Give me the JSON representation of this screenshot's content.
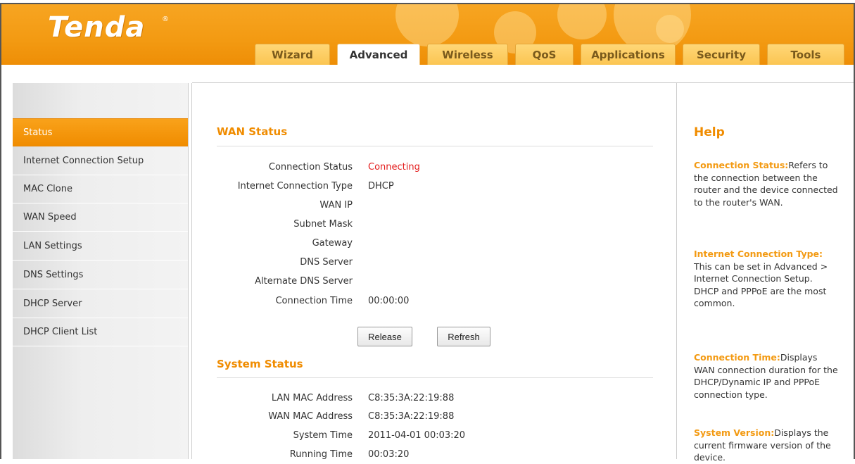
{
  "brand": {
    "logo_text": "Tenda",
    "registered": "®"
  },
  "tabs": [
    {
      "label": "Wizard"
    },
    {
      "label": "Advanced"
    },
    {
      "label": "Wireless"
    },
    {
      "label": "QoS"
    },
    {
      "label": "Applications"
    },
    {
      "label": "Security"
    },
    {
      "label": "Tools"
    }
  ],
  "active_tab": "Advanced",
  "sidebar": {
    "items": [
      {
        "label": "Status"
      },
      {
        "label": "Internet Connection Setup"
      },
      {
        "label": "MAC Clone"
      },
      {
        "label": "WAN Speed"
      },
      {
        "label": "LAN Settings"
      },
      {
        "label": "DNS Settings"
      },
      {
        "label": "DHCP Server"
      },
      {
        "label": "DHCP Client List"
      }
    ],
    "active": "Status"
  },
  "wan": {
    "title": "WAN Status",
    "rows": [
      {
        "label": "Connection Status",
        "value": "Connecting"
      },
      {
        "label": "Internet Connection Type",
        "value": "DHCP"
      },
      {
        "label": "WAN IP",
        "value": ""
      },
      {
        "label": "Subnet Mask",
        "value": ""
      },
      {
        "label": "Gateway",
        "value": ""
      },
      {
        "label": "DNS Server",
        "value": ""
      },
      {
        "label": "Alternate DNS Server",
        "value": ""
      },
      {
        "label": "Connection Time",
        "value": "00:00:00"
      }
    ],
    "release_label": "Release",
    "refresh_label": "Refresh"
  },
  "system": {
    "title": "System Status",
    "rows": [
      {
        "label": "LAN MAC Address",
        "value": "C8:35:3A:22:19:88"
      },
      {
        "label": "WAN MAC Address",
        "value": "C8:35:3A:22:19:88"
      },
      {
        "label": "System Time",
        "value": "2011-04-01 00:03:20"
      },
      {
        "label": "Running Time",
        "value": "00:03:20"
      }
    ]
  },
  "help": {
    "title": "Help",
    "blocks": [
      {
        "keyword": "Connection Status:",
        "text": "Refers to the connection between the router and the device connected to the router's WAN."
      },
      {
        "keyword": "Internet Connection Type:",
        "text": "This can be set in Advanced > Internet Connection Setup. DHCP and PPPoE are the most common."
      },
      {
        "keyword": "Connection Time:",
        "text": "Displays WAN connection duration for the DHCP/Dynamic IP and PPPoE connection type."
      },
      {
        "keyword": "System Version:",
        "text": "Displays the current firmware version of the device."
      }
    ]
  },
  "colors": {
    "accent": "#f39a12",
    "status_connecting": "#e31b1b"
  }
}
